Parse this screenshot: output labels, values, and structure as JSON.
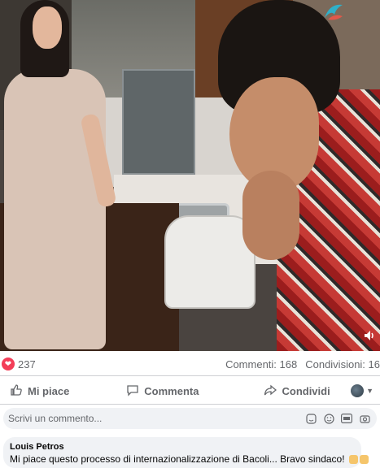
{
  "post": {
    "reaction_count": "237",
    "comments_label": "Commenti: 168",
    "shares_label": "Condivisioni: 16"
  },
  "actions": {
    "like_label": "Mi piace",
    "comment_label": "Commenta",
    "share_label": "Condividi"
  },
  "comment_box": {
    "placeholder": "Scrivi un commento..."
  },
  "comments": [
    {
      "author": "Louis Petros",
      "text": "Mi piace questo processo di internazionalizzazione di Bacoli... Bravo sindaco!"
    }
  ],
  "icons": {
    "reaction": "love-icon",
    "like": "thumbs-up-icon",
    "comment": "speech-bubble-icon",
    "share": "share-arrow-icon",
    "audience": "globe-icon",
    "sticker": "sticker-icon",
    "emoji": "smiley-icon",
    "gif": "gif-icon",
    "camera": "camera-icon",
    "volume": "speaker-icon"
  },
  "colors": {
    "reaction_red": "#f33e58",
    "text_secondary": "#65676b",
    "input_bg": "#f0f2f5"
  }
}
